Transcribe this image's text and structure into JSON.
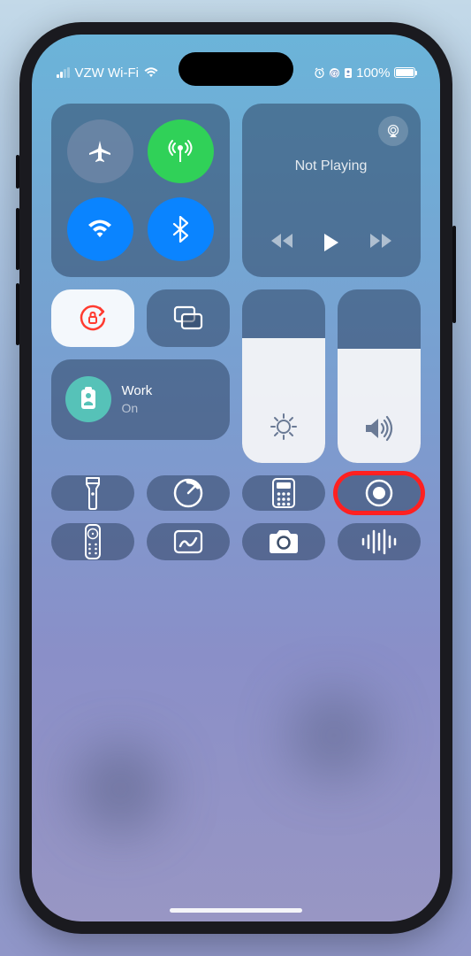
{
  "status_bar": {
    "carrier": "VZW Wi-Fi",
    "battery_percent": "100%",
    "icons": [
      "alarm-icon",
      "at-icon",
      "badge-icon"
    ]
  },
  "connectivity": {
    "airplane": {
      "active": false
    },
    "cellular": {
      "active": true
    },
    "wifi": {
      "active": true
    },
    "bluetooth": {
      "active": true
    }
  },
  "media": {
    "title": "Not Playing"
  },
  "focus": {
    "label": "Work",
    "state": "On"
  },
  "sliders": {
    "brightness": 72,
    "volume": 66
  },
  "tiles": [
    "orientation-lock",
    "screen-mirroring",
    "flashlight",
    "timer",
    "calculator",
    "screen-record",
    "apple-tv-remote",
    "freeform",
    "camera",
    "shazam"
  ],
  "highlighted_tile": "screen-record",
  "colors": {
    "active_blue": "#0a84ff",
    "active_green": "#30d158",
    "highlight_red": "#ff2020",
    "lock_accent": "#ff3b30",
    "focus_teal": "#56c2b8"
  }
}
